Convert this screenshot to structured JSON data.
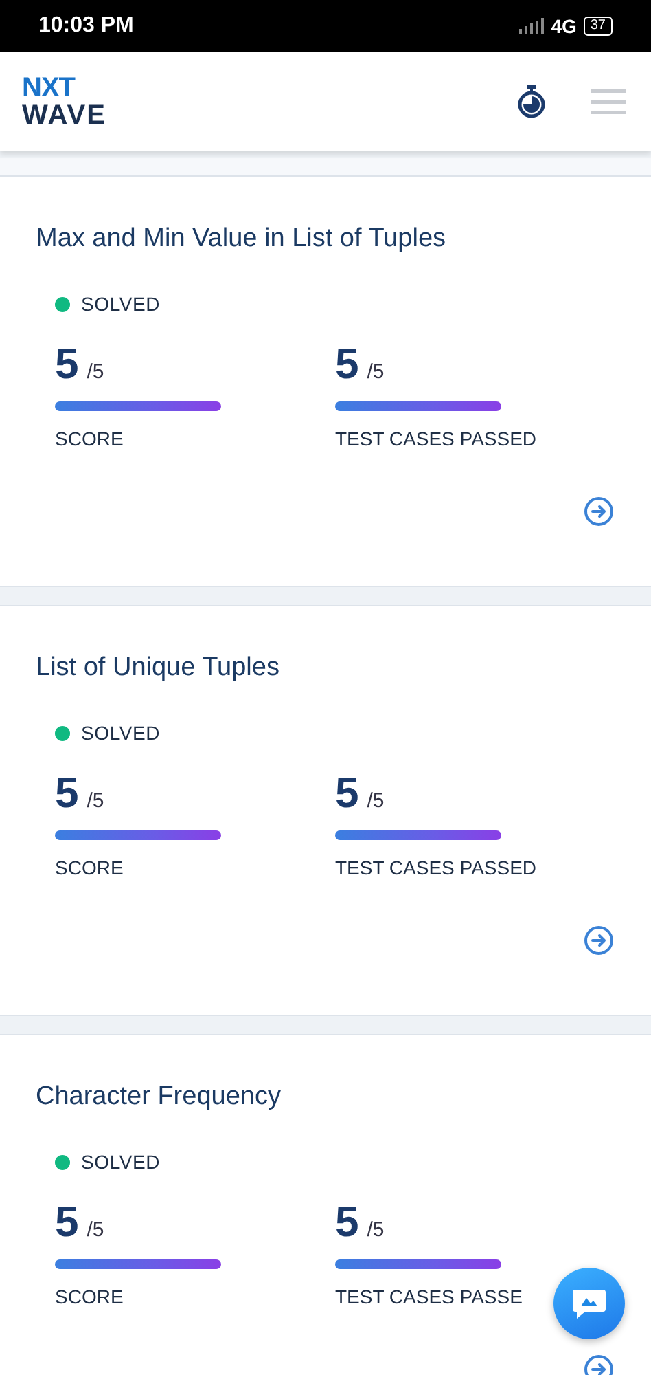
{
  "status_bar": {
    "time": "10:03 PM",
    "network": "4G",
    "battery": "37"
  },
  "header": {
    "logo_top": "NXT",
    "logo_bottom": "WAVE"
  },
  "problems": [
    {
      "title": "Max and Min Value in List of Tuples",
      "status": "SOLVED",
      "metrics": [
        {
          "value": "5",
          "total": "/5",
          "level": 1,
          "label": "SCORE"
        },
        {
          "value": "5",
          "total": "/5",
          "level": 1,
          "label": "TEST CASES PASSED"
        }
      ]
    },
    {
      "title": "List of Unique Tuples",
      "status": "SOLVED",
      "metrics": [
        {
          "value": "5",
          "total": "/5",
          "level": 1,
          "label": "SCORE"
        },
        {
          "value": "5",
          "total": "/5",
          "level": 1,
          "label": "TEST CASES PASSED"
        }
      ]
    },
    {
      "title": "Character Frequency",
      "status": "SOLVED",
      "metrics": [
        {
          "value": "5",
          "total": "/5",
          "level": 1,
          "label": "SCORE"
        },
        {
          "value": "5",
          "total": "/5",
          "level": 1,
          "label": "TEST CASES PASSE"
        }
      ]
    }
  ]
}
